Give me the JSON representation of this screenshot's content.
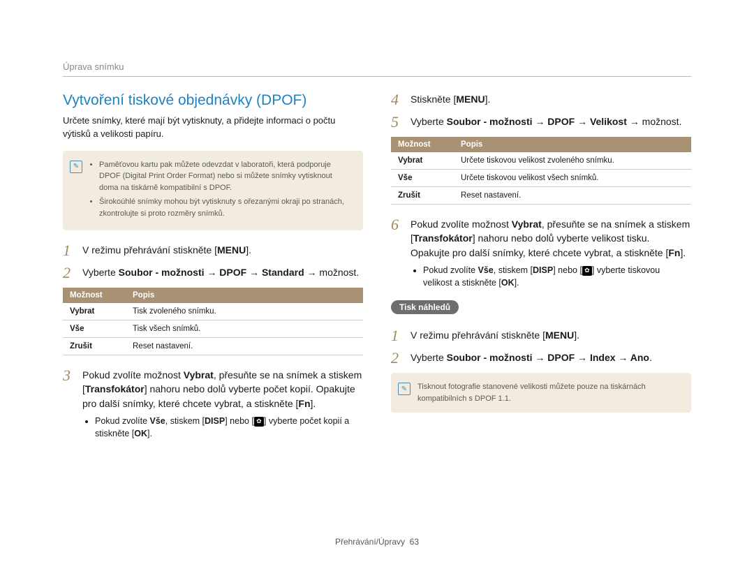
{
  "breadcrumb": "Úprava snímku",
  "heading": "Vytvoření tiskové objednávky (DPOF)",
  "intro": "Určete snímky, které mají být vytisknuty, a přidejte informaci o počtu výtisků a velikosti papíru.",
  "note1": {
    "items": [
      "Paměťovou kartu pak můžete odevzdat v laboratoři, která podporuje DPOF (Digital Print Order Format) nebo si můžete snímky vytisknout doma na tiskárně kompatibilní s DPOF.",
      "Širokoúhlé snímky mohou být vytisknuty s ořezanými okraji po stranách, zkontrolujte si proto rozměry snímků."
    ]
  },
  "labels": {
    "menu": "MENU",
    "disp": "DISP",
    "fn": "Fn",
    "ok": "OK",
    "option": "Možnost",
    "desc": "Popis"
  },
  "left_steps": {
    "s1": {
      "num": "1",
      "text_a": "V režimu přehrávání stiskněte [",
      "text_b": "]."
    },
    "s2": {
      "num": "2",
      "text_a": "Vyberte ",
      "bold": "Soubor - možnosti → DPOF → Standard →",
      "text_b": " možnost."
    },
    "s3": {
      "num": "3",
      "parts": {
        "a": "Pokud zvolíte možnost ",
        "b": "Vybrat",
        "c": ", přesuňte se na snímek a stiskem [",
        "d": "Transfokátor",
        "e": "] nahoru nebo dolů vyberte počet kopií. Opakujte pro další snímky, které chcete vybrat, a stiskněte ["
      },
      "bullet": {
        "a": "Pokud zvolíte ",
        "b": "Vše",
        "c": ", stiskem [",
        "d": "] nebo [",
        "e": "] vyberte počet kopií a stiskněte ["
      }
    }
  },
  "table1": {
    "rows": [
      {
        "opt": "Vybrat",
        "desc": "Tisk zvoleného snímku."
      },
      {
        "opt": "Vše",
        "desc": "Tisk všech snímků."
      },
      {
        "opt": "Zrušit",
        "desc": "Reset nastavení."
      }
    ]
  },
  "right_steps": {
    "s4": {
      "num": "4",
      "text_a": "Stiskněte [",
      "text_b": "]."
    },
    "s5": {
      "num": "5",
      "text_a": "Vyberte ",
      "bold": "Soubor - možnosti → DPOF → Velikost →",
      "text_b": " možnost."
    },
    "s6": {
      "num": "6",
      "parts": {
        "a": "Pokud zvolíte možnost ",
        "b": "Vybrat",
        "c": ", přesuňte se na snímek a stiskem [",
        "d": "Transfokátor",
        "e": "] nahoru nebo dolů vyberte velikost tisku. Opakujte pro další snímky, které chcete vybrat, a stiskněte ["
      },
      "bullet": {
        "a": "Pokud zvolíte ",
        "b": "Vše",
        "c": ", stiskem [",
        "d": "] nebo [",
        "e": "] vyberte tiskovou velikost a stiskněte ["
      }
    }
  },
  "table2": {
    "rows": [
      {
        "opt": "Vybrat",
        "desc": "Určete tiskovou velikost zvoleného snímku."
      },
      {
        "opt": "Vše",
        "desc": "Určete tiskovou velikost všech snímků."
      },
      {
        "opt": "Zrušit",
        "desc": "Reset nastavení."
      }
    ]
  },
  "pill": "Tisk náhledů",
  "thumb_steps": {
    "s1": {
      "num": "1",
      "text_a": "V režimu přehrávání stiskněte [",
      "text_b": "]."
    },
    "s2": {
      "num": "2",
      "text_a": "Vyberte ",
      "bold": "Soubor - možnosti → DPOF → Index → Ano",
      "text_b": "."
    }
  },
  "note2": "Tisknout fotografie stanovené velikosti můžete pouze na tiskárnách kompatibilních s DPOF 1.1.",
  "footer": {
    "section": "Přehrávání/Úpravy",
    "page": "63"
  }
}
